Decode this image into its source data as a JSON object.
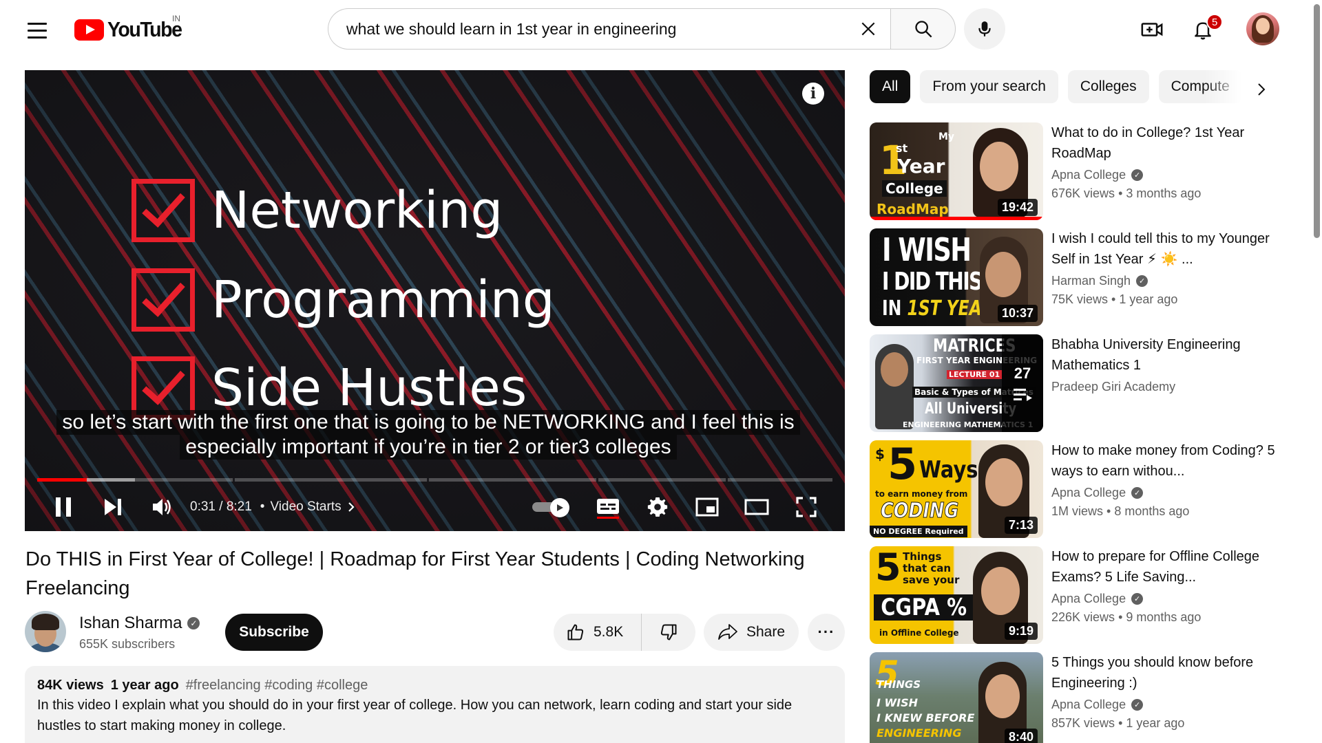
{
  "header": {
    "logo_text": "YouTube",
    "country_code": "IN",
    "search_value": "what we should learn in 1st year in engineering",
    "notification_count": "5"
  },
  "player": {
    "overlay_lines": [
      "Networking",
      "Programming",
      "Side Hustles"
    ],
    "caption_line1": "so let’s start with the first one that is going to be NETWORKING and I feel this is",
    "caption_line2": "especially important if you’re in tier 2 or tier3 colleges",
    "time": "0:31 / 8:21",
    "chapter": "Video Starts",
    "played_fraction": 0.062,
    "buffered_fraction": 0.123,
    "accent": "#ff0000"
  },
  "video": {
    "title": "Do THIS in First Year of College! | Roadmap for First Year Students | Coding Networking Freelancing",
    "channel": "Ishan Sharma",
    "subscribers": "655K subscribers",
    "subscribe_label": "Subscribe",
    "likes": "5.8K",
    "share_label": "Share",
    "views": "84K views",
    "age": "1 year ago",
    "tags": "#freelancing #coding #college",
    "description": "In this video I explain what you should do in your first year of college. How you can network, learn coding and start your side hustles to start making money in college."
  },
  "chips": [
    "All",
    "From your search",
    "Colleges",
    "Compute"
  ],
  "recommendations": [
    {
      "title": "What to do in College? 1st Year RoadMap",
      "channel": "Apna College",
      "verified": true,
      "views": "676K views",
      "age": "3 months ago",
      "duration": "19:42"
    },
    {
      "title": "I wish I could tell this to my Younger Self in 1st Year ⚡ ☀️ ...",
      "channel": "Harman Singh",
      "verified": true,
      "views": "75K views",
      "age": "1 year ago",
      "duration": "10:37"
    },
    {
      "title": "Bhabha University Engineering Mathematics 1",
      "channel": "Pradeep Giri Academy",
      "verified": false,
      "views": "",
      "age": "",
      "duration": "27"
    },
    {
      "title": "How to make money from Coding? 5 ways to earn withou...",
      "channel": "Apna College",
      "verified": true,
      "views": "1M views",
      "age": "8 months ago",
      "duration": "7:13"
    },
    {
      "title": "How to prepare for Offline College Exams? 5 Life Saving...",
      "channel": "Apna College",
      "verified": true,
      "views": "226K views",
      "age": "9 months ago",
      "duration": "9:19"
    },
    {
      "title": "5 Things you should know before Engineering :)",
      "channel": "Apna College",
      "verified": true,
      "views": "857K views",
      "age": "1 year ago",
      "duration": "8:40"
    }
  ],
  "thumb_text": {
    "t1": {
      "num": "1",
      "st": "st",
      "my": "My",
      "year": "Year",
      "college": "College",
      "roadmap": "RoadMap"
    },
    "t2": {
      "l1": "I WISH",
      "l2": "I DID THIS",
      "l3a": "IN ",
      "l3b": "1ST YEAR"
    },
    "t3": {
      "l1": "MATRICES",
      "l2": "FIRST YEAR ENGINEERING",
      "l3": "LECTURE 01",
      "l4": "Basic & Types of Matrices",
      "l5": "All University",
      "l6": "ENGINEERING MATHEMATICS 1"
    },
    "t4": {
      "num": "5",
      "ways": "Ways",
      "earn": "to earn money from",
      "coding": "CODING",
      "nodeg": "NO DEGREE Required"
    },
    "t5": {
      "num": "5",
      "things": "Things",
      "that": "that can",
      "save": "save your",
      "cgpa": "CGPA %",
      "offline": "in Offline College"
    },
    "t6": {
      "num": "5",
      "things": "THINGS",
      "iwish": "I WISH",
      "knew": "I KNEW BEFORE",
      "eng": "ENGINEERING"
    }
  }
}
